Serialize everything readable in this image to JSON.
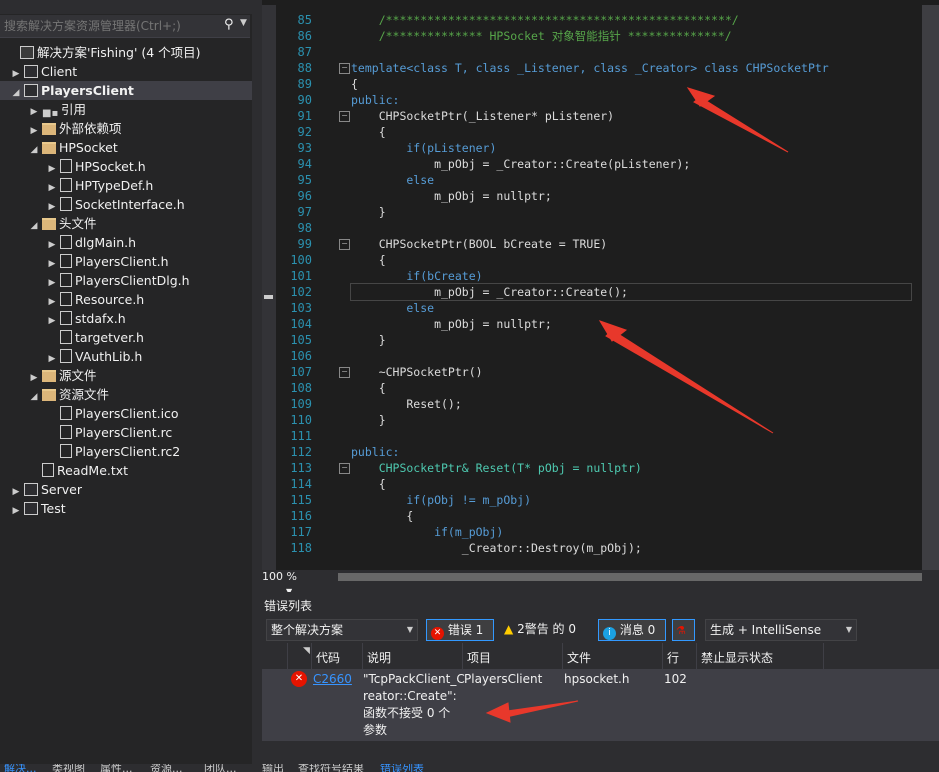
{
  "search": {
    "placeholder": "搜索解决方案资源管理器(Ctrl+;)"
  },
  "tree": [
    {
      "label": "解决方案'Fishing' (4 个项目)",
      "icon": "solution-icon",
      "twisty": ""
    },
    {
      "label": "Client",
      "icon": "project-icon",
      "twisty": "▶"
    },
    {
      "label": "PlayersClient",
      "icon": "project-icon",
      "twisty": "◢",
      "selected": true
    },
    {
      "label": "引用",
      "icon": "reference-icon",
      "twisty": "▶"
    },
    {
      "label": "外部依赖项",
      "icon": "folder-icon",
      "twisty": "▶"
    },
    {
      "label": "HPSocket",
      "icon": "folder-icon",
      "twisty": "◢"
    },
    {
      "label": "HPSocket.h",
      "icon": "header-file-icon",
      "twisty": "▶"
    },
    {
      "label": "HPTypeDef.h",
      "icon": "header-file-icon",
      "twisty": "▶"
    },
    {
      "label": "SocketInterface.h",
      "icon": "header-file-icon",
      "twisty": "▶"
    },
    {
      "label": "头文件",
      "icon": "folder-icon",
      "twisty": "◢"
    },
    {
      "label": "dlgMain.h",
      "icon": "header-file-icon",
      "twisty": "▶"
    },
    {
      "label": "PlayersClient.h",
      "icon": "header-file-icon",
      "twisty": "▶"
    },
    {
      "label": "PlayersClientDlg.h",
      "icon": "header-file-icon",
      "twisty": "▶"
    },
    {
      "label": "Resource.h",
      "icon": "header-file-icon",
      "twisty": "▶"
    },
    {
      "label": "stdafx.h",
      "icon": "header-file-icon",
      "twisty": "▶"
    },
    {
      "label": "targetver.h",
      "icon": "header-file-icon",
      "twisty": ""
    },
    {
      "label": "VAuthLib.h",
      "icon": "header-file-icon",
      "twisty": "▶"
    },
    {
      "label": "源文件",
      "icon": "folder-icon",
      "twisty": "▶"
    },
    {
      "label": "资源文件",
      "icon": "folder-icon",
      "twisty": "◢"
    },
    {
      "label": "PlayersClient.ico",
      "icon": "image-file-icon",
      "twisty": ""
    },
    {
      "label": "PlayersClient.rc",
      "icon": "resource-file-icon",
      "twisty": ""
    },
    {
      "label": "PlayersClient.rc2",
      "icon": "resource-file-icon",
      "twisty": ""
    },
    {
      "label": "ReadMe.txt",
      "icon": "text-file-icon",
      "twisty": ""
    },
    {
      "label": "Server",
      "icon": "project-icon",
      "twisty": "▶"
    },
    {
      "label": "Test",
      "icon": "project-icon",
      "twisty": "▶"
    }
  ],
  "editor": {
    "lines": [
      {
        "n": "85",
        "code": "    /**************************************************/"
      },
      {
        "n": "86",
        "code": "    /************** HPSocket 对象智能指针 **************/"
      },
      {
        "n": "87",
        "code": ""
      },
      {
        "n": "88",
        "code": "template<class T, class _Listener, class _Creator> class CHPSocketPtr"
      },
      {
        "n": "89",
        "code": "{"
      },
      {
        "n": "90",
        "code": "public:"
      },
      {
        "n": "91",
        "code": "    CHPSocketPtr(_Listener* pListener)"
      },
      {
        "n": "92",
        "code": "    {"
      },
      {
        "n": "93",
        "code": "        if(pListener)"
      },
      {
        "n": "94",
        "code": "            m_pObj = _Creator::Create(pListener);"
      },
      {
        "n": "95",
        "code": "        else"
      },
      {
        "n": "96",
        "code": "            m_pObj = nullptr;"
      },
      {
        "n": "97",
        "code": "    }"
      },
      {
        "n": "98",
        "code": ""
      },
      {
        "n": "99",
        "code": "    CHPSocketPtr(BOOL bCreate = TRUE)"
      },
      {
        "n": "100",
        "code": "    {"
      },
      {
        "n": "101",
        "code": "        if(bCreate)"
      },
      {
        "n": "102",
        "code": "            m_pObj = _Creator::Create();"
      },
      {
        "n": "103",
        "code": "        else"
      },
      {
        "n": "104",
        "code": "            m_pObj = nullptr;"
      },
      {
        "n": "105",
        "code": "    }"
      },
      {
        "n": "106",
        "code": ""
      },
      {
        "n": "107",
        "code": "    ~CHPSocketPtr()"
      },
      {
        "n": "108",
        "code": "    {"
      },
      {
        "n": "109",
        "code": "        Reset();"
      },
      {
        "n": "110",
        "code": "    }"
      },
      {
        "n": "111",
        "code": ""
      },
      {
        "n": "112",
        "code": "public:"
      },
      {
        "n": "113",
        "code": "    CHPSocketPtr& Reset(T* pObj = nullptr)"
      },
      {
        "n": "114",
        "code": "    {"
      },
      {
        "n": "115",
        "code": "        if(pObj != m_pObj)"
      },
      {
        "n": "116",
        "code": "        {"
      },
      {
        "n": "117",
        "code": "            if(m_pObj)"
      },
      {
        "n": "118",
        "code": "                _Creator::Destroy(m_pObj);"
      }
    ],
    "zoom": "100 %"
  },
  "error_list": {
    "title": "错误列表",
    "scope": "整个解决方案",
    "errors_btn": "错误 1",
    "warnings_btn": "2警告 的 0",
    "messages_btn": "消息 0",
    "build_filter": "生成 + IntelliSense",
    "columns": [
      "代码",
      "说明",
      "项目",
      "文件",
      "行",
      "禁止显示状态"
    ],
    "row": {
      "code": "C2660",
      "desc1": "\"TcpPackClient_C",
      "desc2": "reator::Create\":",
      "desc3": "函数不接受 0 个",
      "desc4": "参数",
      "project": "PlayersClient",
      "file": "hpsocket.h",
      "line": "102",
      "suppress": ""
    }
  },
  "bottom_tabs": [
    "解决...",
    "类视图",
    "属性...",
    "资源...",
    "团队...",
    "输出",
    "查找符号结果",
    "错误列表"
  ],
  "colors": {
    "accent": "#007acc",
    "error_red": "#e51400",
    "annotation_arrow": "#e8382b"
  }
}
